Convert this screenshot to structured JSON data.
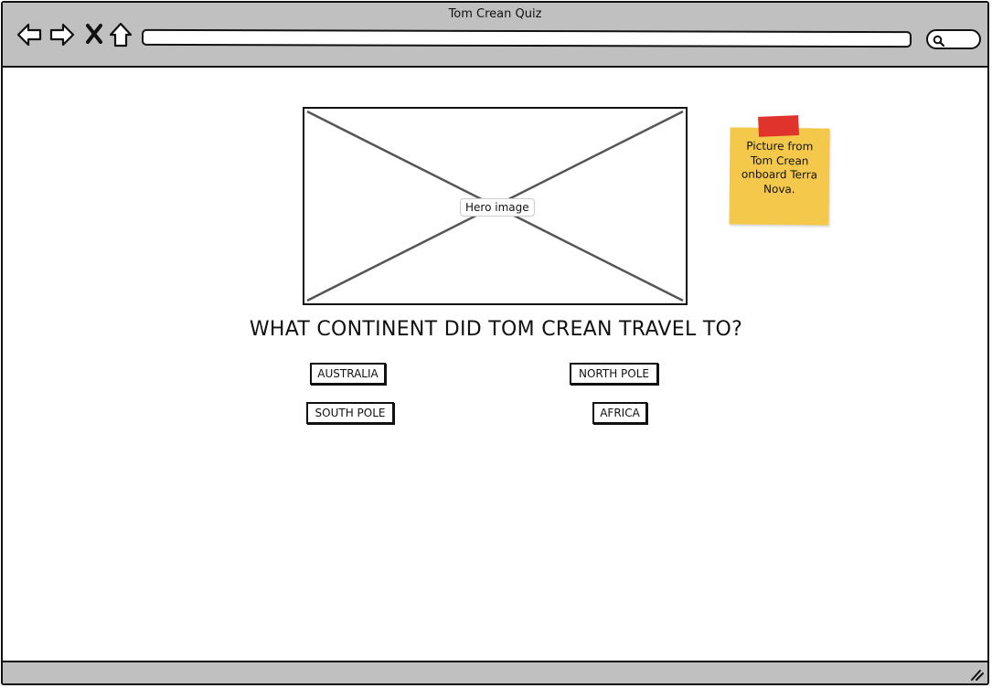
{
  "window": {
    "title": "Tom Crean Quiz"
  },
  "toolbar": {
    "icons": [
      "back-arrow-icon",
      "forward-arrow-icon",
      "close-x-icon",
      "home-icon",
      "search-icon"
    ],
    "url": "",
    "search": ""
  },
  "hero": {
    "label": "Hero image"
  },
  "sticky_note": {
    "text": "Picture from Tom Crean onboard Terra Nova.",
    "color": "#f4c84a",
    "tape_color": "#e0332b"
  },
  "quiz": {
    "question": "WHAT CONTINENT DID TOM CREAN TRAVEL TO?",
    "answers": [
      "AUSTRALIA",
      "NORTH POLE",
      "SOUTH POLE",
      "AFRICA"
    ]
  }
}
